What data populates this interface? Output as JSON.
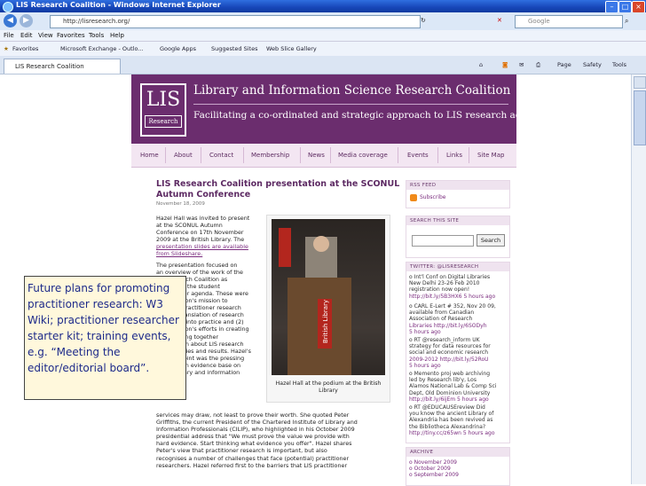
{
  "window": {
    "title": "LIS Research Coalition - Windows Internet Explorer"
  },
  "toolbar": {
    "url": "http://lisresearch.org/",
    "search_placeholder": "Google"
  },
  "menu": [
    "File",
    "Edit",
    "View",
    "Favorites",
    "Tools",
    "Help"
  ],
  "favorites_bar": {
    "favorites_label": "Favorites",
    "items": [
      "Microsoft Exchange - Outlo...",
      "Google Apps",
      "Suggested Sites",
      "Web Slice Gallery"
    ]
  },
  "tab": {
    "label": "LIS Research Coalition"
  },
  "commands": [
    "Page",
    "Safety",
    "Tools"
  ],
  "site": {
    "logo_big": "LIS",
    "logo_small": "Research",
    "title": "Library and Information Science Research Coalition",
    "tagline": "Facilitating a co-ordinated and strategic approach to LIS research across the UK",
    "nav": [
      "Home",
      "About",
      "Contact",
      "Membership",
      "News",
      "Media coverage",
      "Events",
      "Links",
      "Site Map"
    ]
  },
  "article": {
    "title": "LIS Research Coalition presentation at the SCONUL Autumn Conference",
    "date": "November 18, 2009",
    "col_lines": [
      "Hazel Hall was invited to present",
      "at the SCONUL Autumn",
      "Conference on 17th November",
      "2009 at the British Library. The",
      "presentation slides are available",
      "from Slideshare.",
      "The presentation focused on",
      "an overview of the work of the",
      "LIS Research Coalition as",
      "framed by the student",
      "practitioner agenda. These were",
      "the Coalition's mission to",
      "increase practitioner research",
      "and the translation of research",
      "outcomes into practice and (2)",
      "the Coalition's efforts in creating",
      "and bringing together",
      "information about LIS research",
      "opportunities and results. Hazel's",
      "starting point was the pressing",
      "need for an evidence base on",
      "which library and information"
    ],
    "full_lines": [
      "services may draw, not least to prove their worth. She quoted Peter",
      "Griffiths, the current President of the Chartered Institute of Library and",
      "Information Professionals (CILIP), who highlighted in his October 2009",
      "presidential address that \"We must prove the value we provide with",
      "hard evidence. Start thinking what evidence you offer\". Hazel shares",
      "Peter's view that practitioner research is important, but also",
      "recognises a number of challenges that face (potential) practitioner",
      "researchers. Hazel referred first to the barriers that LIS practitioner"
    ],
    "photo_caption": "Hazel Hall at the podium at the British Library",
    "sign_text": "British Library"
  },
  "sidebar": {
    "rss_head": "RSS FEED",
    "subscribe": "Subscribe",
    "search_head": "SEARCH THIS SITE",
    "search_button": "Search",
    "twitter_head": "TWITTER: @LISRESEARCH",
    "tweets": [
      [
        "o Int'l Conf on Digital Libraries",
        "New Delhi 23-26 Feb 2010",
        "registration now open!",
        "http://bit.ly/5B3HX6 5 hours ago"
      ],
      [
        "o CARL E-Lert # 352, Nov 20 09,",
        "available from Canadian",
        "Association of Research",
        "Libraries http://bit.ly/6SODyh",
        "5 hours ago"
      ],
      [
        "o RT @research_inform UK",
        "strategy for data resources for",
        "social and economic research",
        "2009-2012 http://bit.ly/52RoU",
        "5 hours ago"
      ],
      [
        "o Memento proj web archiving",
        "led by Research lib'y, Los",
        "Alamos National Lab & Comp Sci",
        "Dept, Old Dominion University",
        "http://bit.ly/6ijEm 5 hours ago"
      ],
      [
        "o RT @EDUCAUSEreview Did",
        "you know the ancient Library of",
        "Alexandria has been revived as",
        "the Bibliotheca Alexandrina?",
        "http://tiny.cc/z65wn 5 hours ago"
      ]
    ],
    "archive_head": "ARCHIVE",
    "archive": [
      "o November 2009",
      "o October 2009",
      "o September 2009"
    ]
  },
  "callout": {
    "text": "Future plans for promoting practitioner research: W3 Wiki; practitioner researcher starter kit; training events, e.g. “Meeting the editor/editorial board”."
  }
}
